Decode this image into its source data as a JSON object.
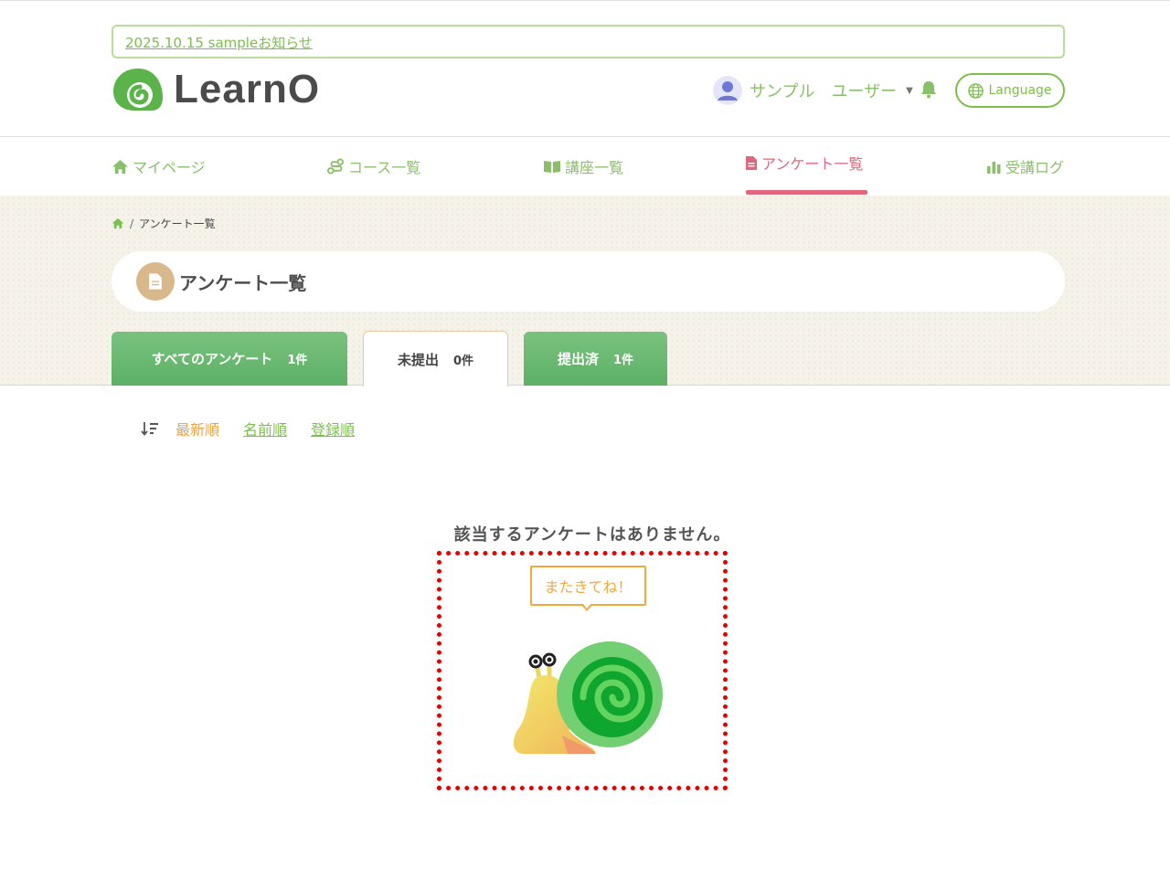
{
  "header": {
    "notice": "2025.10.15 sampleお知らせ",
    "logo_text": "LearnO",
    "user_name": "サンプル　ユーザー",
    "language_label": "Language"
  },
  "nav": {
    "items": [
      {
        "label": "マイページ",
        "icon": "home-icon"
      },
      {
        "label": "コース一覧",
        "icon": "route-icon"
      },
      {
        "label": "講座一覧",
        "icon": "book-icon"
      },
      {
        "label": "アンケート一覧",
        "icon": "document-icon",
        "active": true
      },
      {
        "label": "受講ログ",
        "icon": "bar-chart-icon"
      }
    ]
  },
  "breadcrumb": {
    "separator": "/",
    "current": "アンケート一覧"
  },
  "page": {
    "title": "アンケート一覧"
  },
  "tabs": [
    {
      "label": "すべてのアンケート",
      "count": "1件"
    },
    {
      "label": "未提出",
      "count": "0件",
      "active": true
    },
    {
      "label": "提出済",
      "count": "1件"
    }
  ],
  "sort": {
    "newest": "最新順",
    "name": "名前順",
    "registered": "登録順"
  },
  "empty": {
    "message": "該当するアンケートはありません。",
    "bubble": "またきてね！"
  },
  "colors": {
    "brand_green": "#7cc04b",
    "active_pink": "#e0677d",
    "orange": "#f3a13b",
    "dotted_red": "#e60000"
  }
}
